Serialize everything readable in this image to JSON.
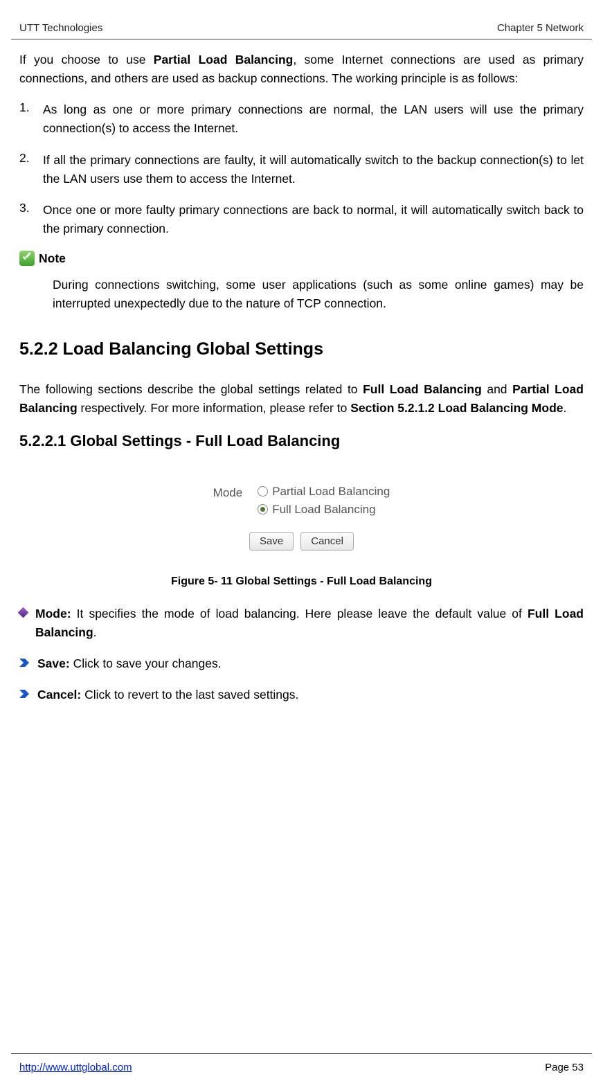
{
  "header": {
    "left": "UTT Technologies",
    "right": "Chapter 5 Network"
  },
  "intro": {
    "pre": "If you choose to use ",
    "bold": "Partial Load Balancing",
    "post": ", some Internet connections are used as primary connections, and others are used as backup connections. The working principle is as follows:"
  },
  "list": {
    "item1_num": "1.",
    "item1": "As long as one or more primary connections are normal, the LAN users will use the primary connection(s) to access the Internet.",
    "item2_num": "2.",
    "item2": "If all the primary connections are faulty, it will automatically switch to the backup connection(s) to let the LAN users use them to access the Internet.",
    "item3_num": "3.",
    "item3": "Once one or more faulty primary connections are back to normal, it will automatically switch back to the primary connection."
  },
  "note_label": "Note",
  "note_text": "During connections switching, some user applications (such as some online games) may be interrupted unexpectedly due to the nature of TCP connection.",
  "h2": "5.2.2    Load Balancing Global Settings",
  "para2": {
    "p1": "The following sections describe the global settings related to ",
    "b1": "Full Load Balancing",
    "p2": " and ",
    "b2": "Partial Load Balancing",
    "p3": " respectively. For more information, please refer to ",
    "b3": "Section 5.2.1.2 Load Balancing Mode",
    "p4": "."
  },
  "h3": "5.2.2.1               Global Settings - Full Load Balancing",
  "figure": {
    "mode_label": "Mode",
    "radio1": "Partial Load Balancing",
    "radio2": "Full Load Balancing",
    "save_btn": "Save",
    "cancel_btn": "Cancel",
    "caption": "Figure 5- 11 Global Settings - Full Load Balancing"
  },
  "bullets": {
    "mode_bold": "Mode:",
    "mode_pre": " It specifies the mode of load balancing. Here please leave the default value of ",
    "mode_b2": "Full Load Balancing",
    "mode_post": ".",
    "save_bold": "Save:",
    "save_text": " Click to save your changes.",
    "cancel_bold": "Cancel:",
    "cancel_text": " Click to revert to the last saved settings."
  },
  "footer": {
    "url": "http://www.uttglobal.com",
    "page": "Page 53"
  }
}
